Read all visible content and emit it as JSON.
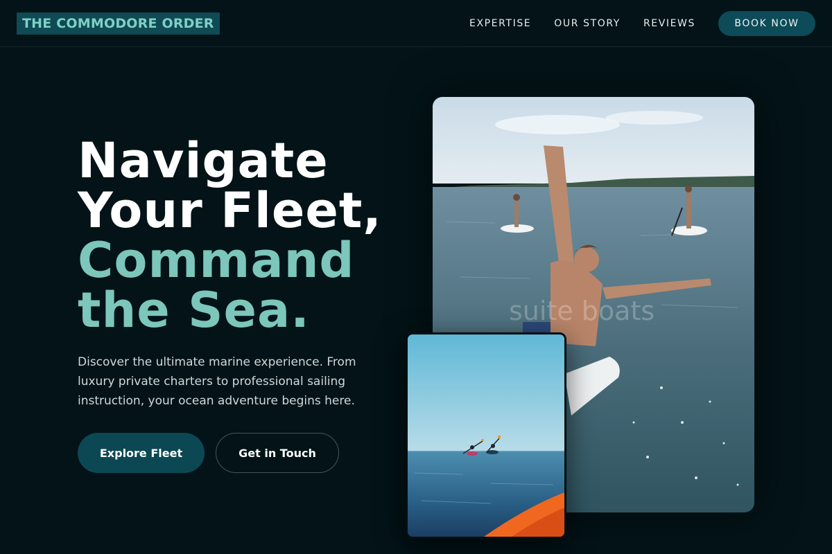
{
  "brand": {
    "logo_text": "THE COMMODORE ORDER"
  },
  "nav": {
    "links": [
      "EXPERTISE",
      "OUR STORY",
      "REVIEWS"
    ],
    "cta": "BOOK NOW"
  },
  "hero": {
    "title_line1": "Navigate",
    "title_line2": "Your Fleet,",
    "title_accent_line1": "Command",
    "title_accent_line2": "the Sea.",
    "description": "Discover the ultimate marine experience. From luxury private charters to professional sailing instruction, your ocean adventure begins here.",
    "primary_button": "Explore Fleet",
    "secondary_button": "Get in Touch"
  },
  "images": {
    "main": {
      "subject": "man-jumping-into-sea-with-paddleboarders",
      "watermark": "suite boats"
    },
    "secondary": {
      "subject": "two-kayakers-on-calm-sea"
    }
  },
  "colors": {
    "background": "#031317",
    "accent": "#7cc6bb",
    "button": "#0c4853",
    "logo_bg": "#0f4a55"
  }
}
